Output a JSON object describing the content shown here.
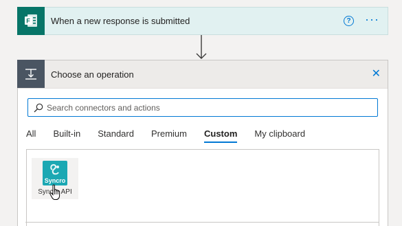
{
  "trigger": {
    "title": "When a new response is submitted",
    "icon": "forms-icon",
    "help_glyph": "?",
    "more_glyph": "···"
  },
  "operation": {
    "title": "Choose an operation",
    "icon": "operation-icon",
    "close_glyph": "✕",
    "search": {
      "placeholder": "Search connectors and actions",
      "value": ""
    },
    "tabs": [
      {
        "label": "All",
        "active": false
      },
      {
        "label": "Built-in",
        "active": false
      },
      {
        "label": "Standard",
        "active": false
      },
      {
        "label": "Premium",
        "active": false
      },
      {
        "label": "Custom",
        "active": true
      },
      {
        "label": "My clipboard",
        "active": false
      }
    ],
    "connectors": [
      {
        "label": "Syncro API",
        "logo_text": "Syncro"
      }
    ]
  },
  "colors": {
    "accent": "#0078d4",
    "trigger_icon_bg": "#077568",
    "trigger_bg": "#e1f1f1",
    "operation_icon_bg": "#4a5562",
    "syncro_logo_bg": "#1ba8b3"
  }
}
